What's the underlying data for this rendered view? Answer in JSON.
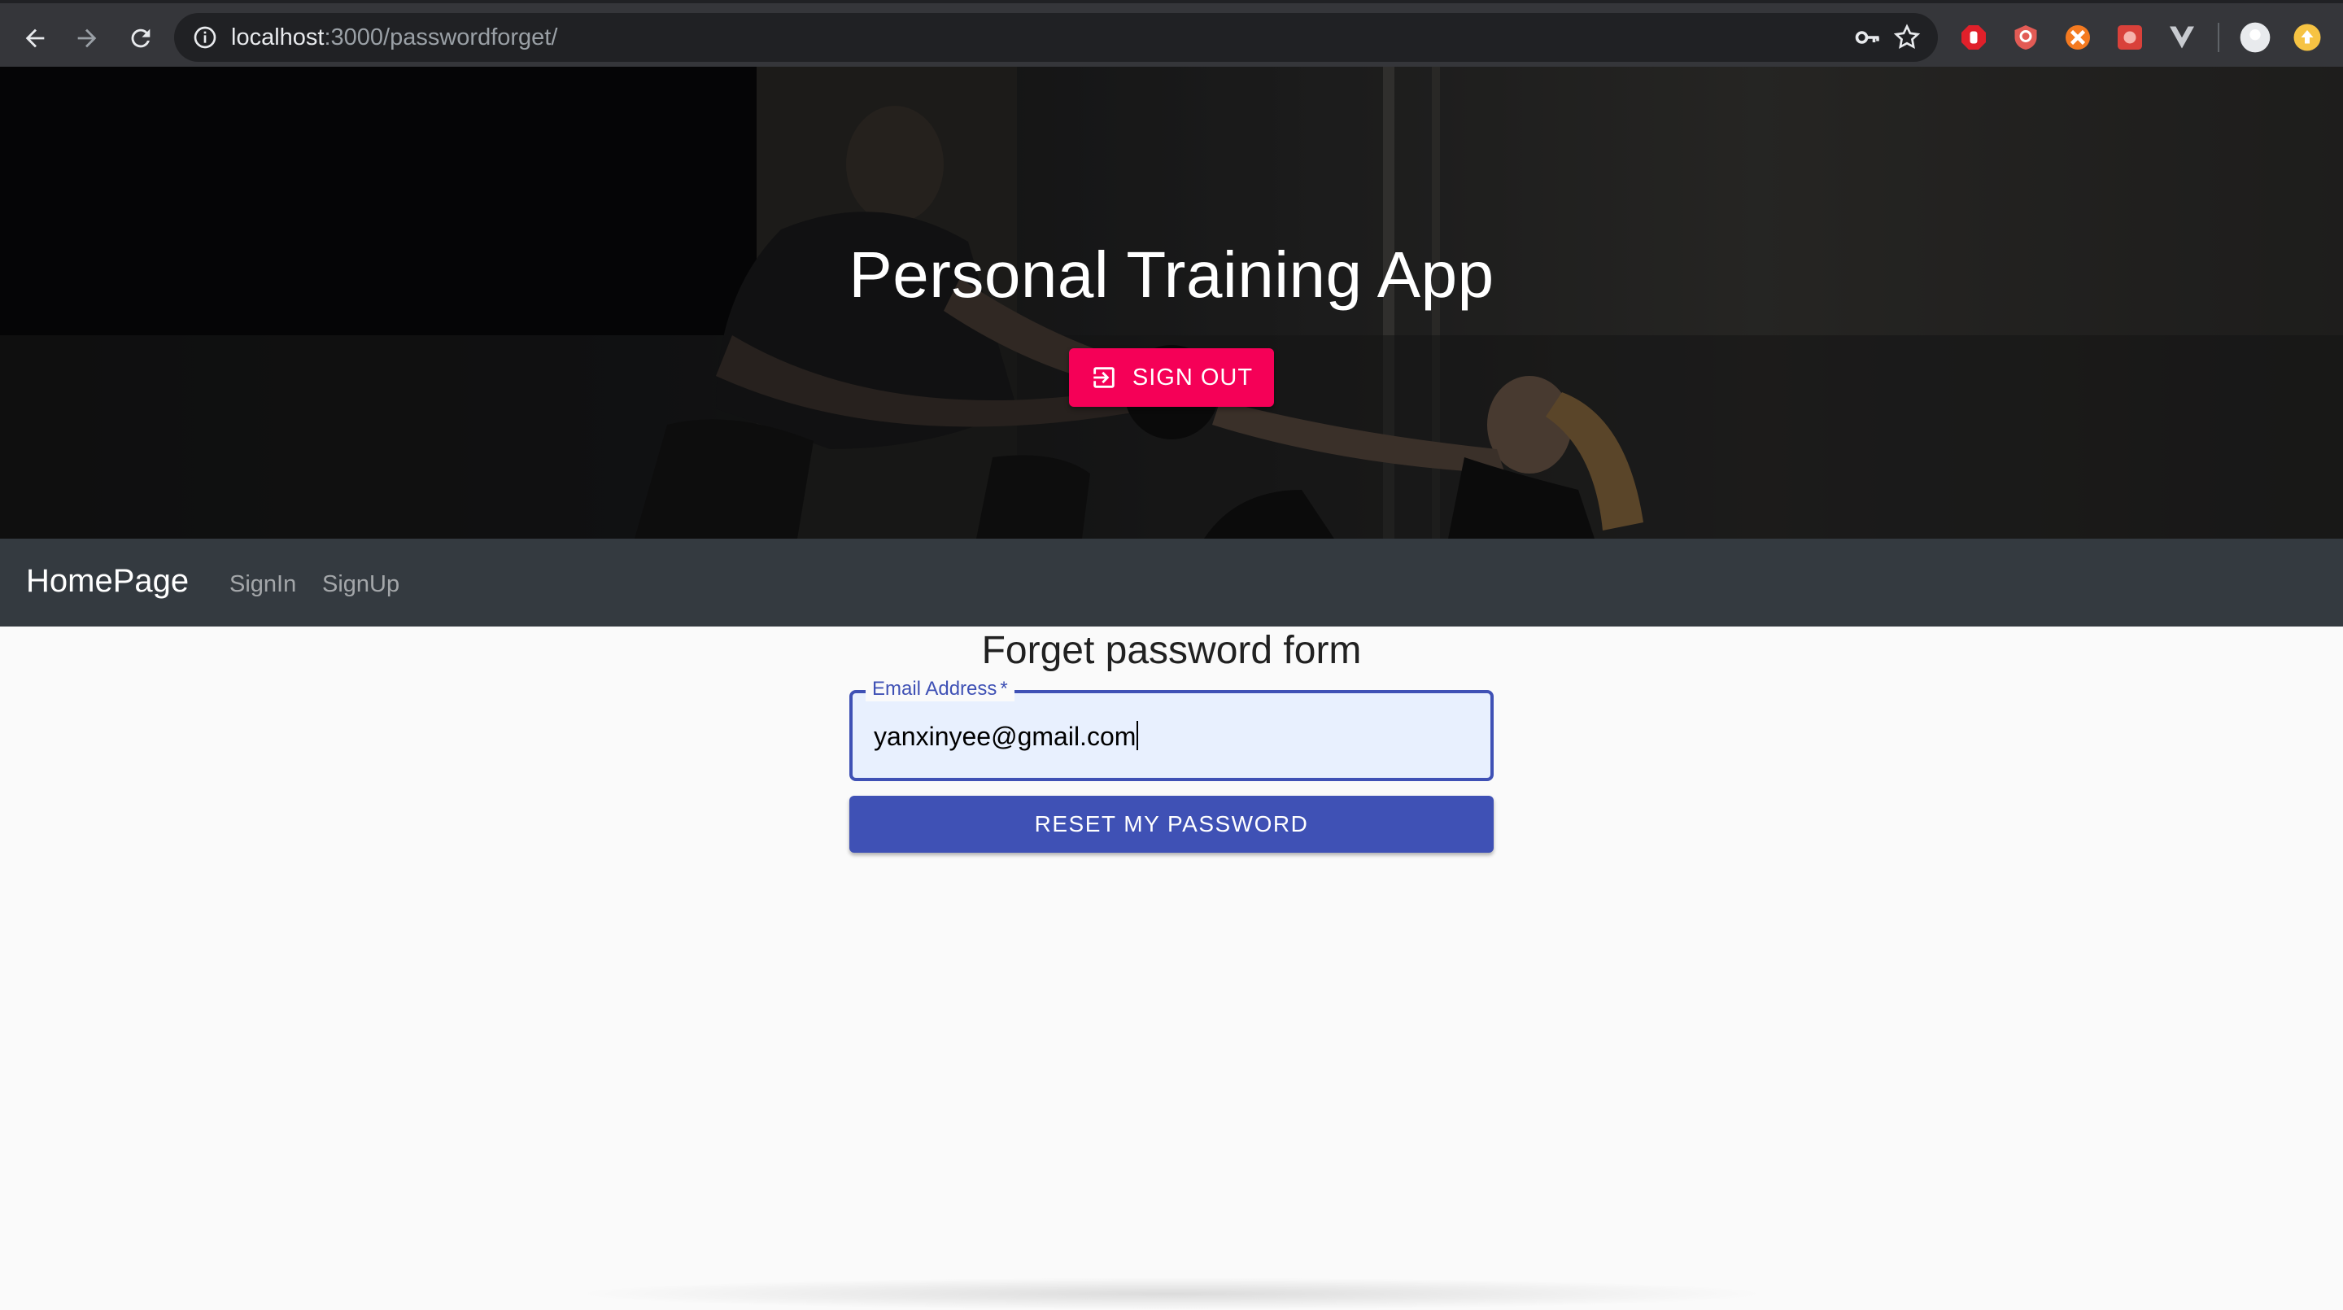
{
  "browser": {
    "url_host": "localhost",
    "url_path": ":3000/passwordforget/"
  },
  "hero": {
    "title": "Personal Training App",
    "signout_label": "SIGN OUT"
  },
  "appbar": {
    "brand": "HomePage",
    "links": [
      "SignIn",
      "SignUp"
    ]
  },
  "form": {
    "title": "Forget password form",
    "email_label": "Email Address",
    "email_required": "*",
    "email_value": "yanxinyee@gmail.com",
    "submit_label": "RESET MY PASSWORD"
  },
  "colors": {
    "primary": "#3f51b5",
    "secondary": "#f50057",
    "appbar": "#343a40"
  }
}
